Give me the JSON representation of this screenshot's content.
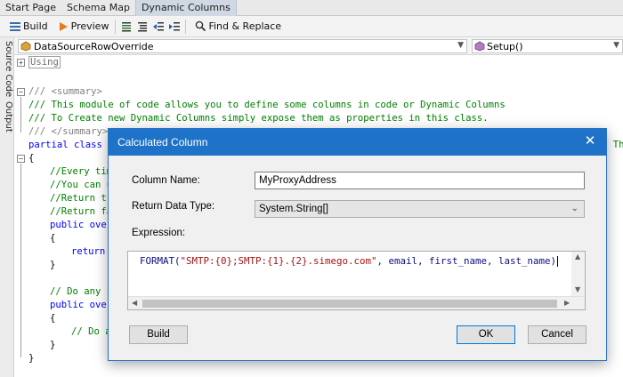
{
  "tabs": [
    "Start Page",
    "Schema Map",
    "Dynamic Columns"
  ],
  "toolbar": {
    "build": "Build",
    "preview": "Preview",
    "find_replace": "Find & Replace"
  },
  "left_tabs": {
    "source_code": "Source Code",
    "output": "Output"
  },
  "selectors": {
    "class_combo": "DataSourceRowOverride",
    "method_combo": "Setup()"
  },
  "code": {
    "using": "Using",
    "l1": "/// <summary>",
    "l2": "/// This module of code allows you to define some columns in code or Dynamic Columns",
    "l3": "/// To Create new Dynamic Columns simply expose them as properties in this class.",
    "l4": "/// </summary>",
    "l5_kw": "partial class D",
    "l5_tail": "e Th",
    "l6": "{",
    "l7": "//Every tim",
    "l8": "//You can u",
    "l9": "//Return tr",
    "l10": "//Return fa",
    "l11": "public over",
    "l12": "{",
    "l13": "return",
    "l14": "}",
    "l15": "// Do any s",
    "l16": "public over",
    "l17": "{",
    "l18": "// Do a",
    "l19": "}",
    "l20": "}"
  },
  "dialog": {
    "title": "Calculated Column",
    "column_name_label": "Column Name:",
    "column_name_value": "MyProxyAddress",
    "return_type_label": "Return Data Type:",
    "return_type_value": "System.String[]",
    "expression_label": "Expression:",
    "expr_fn": "FORMAT(",
    "expr_str": "\"SMTP:{0};SMTP:{1}.{2}.simego.com\"",
    "expr_args": ", email, first_name, last_name)",
    "build_button": "Build",
    "ok_button": "OK",
    "cancel_button": "Cancel"
  },
  "colors": {
    "dialog_title_bg": "#1e73c8",
    "comment_green": "#008000",
    "keyword_blue": "#0000ff",
    "string_red": "#a31515"
  }
}
